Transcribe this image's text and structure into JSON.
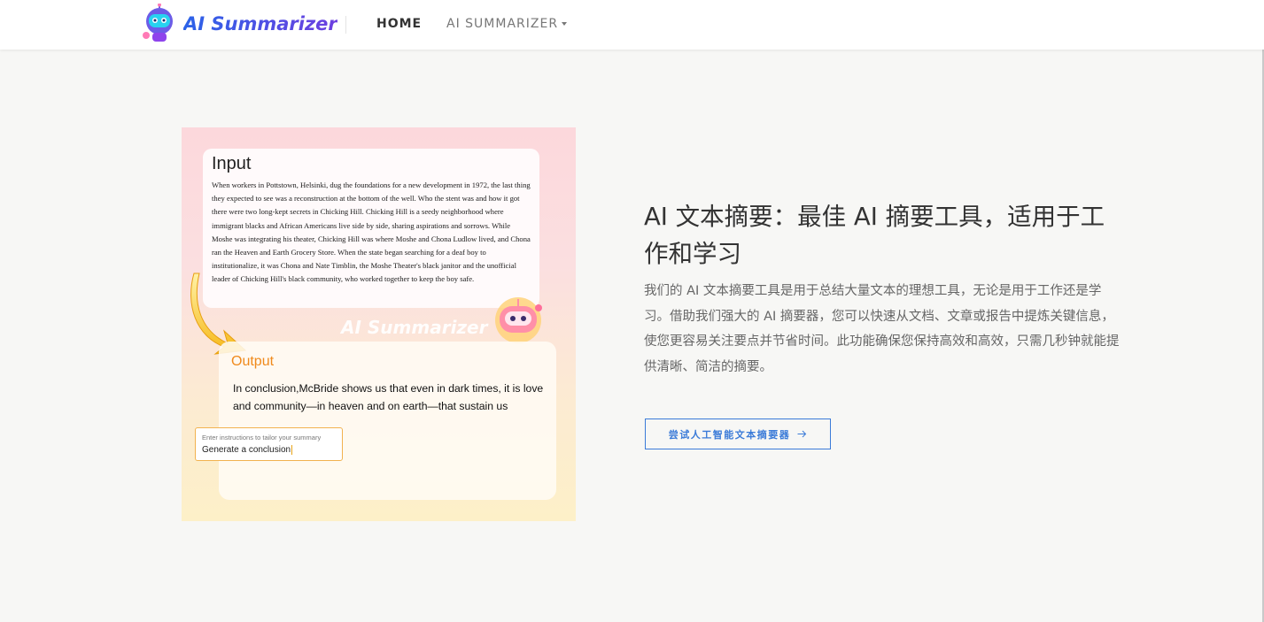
{
  "header": {
    "logo_text": "AI Summarizer",
    "nav": [
      {
        "label": "HOME"
      },
      {
        "label": "AI SUMMARIZER"
      }
    ]
  },
  "illustration": {
    "input_title": "Input",
    "input_text": "When workers in Pottstown, Helsinki, dug the foundations for a new development in 1972, the last thing they expected to see was a reconstruction at the bottom of the well. Who the stent was and how it got there were two long-kept secrets in Chicking Hill. Chicking Hill is a seedy neighborhood where immigrant blacks and African Americans live side by side, sharing aspirations and sorrows. While Moshe was integrating his theater, Chicking Hill was where Moshe and Chona Ludlow lived, and Chona ran the Heaven and Earth Grocery Store. When the state began searching for a deaf boy to institutionalize, it was Chona and Nate Timblin, the Moshe Theater's black janitor and the unofficial leader of Chicking Hill's black community, who worked together to keep the boy safe.",
    "watermark": "AI Summarizer",
    "output_title": "Output",
    "output_text": "In conclusion,McBride shows us that even in dark times, it is love and community—in heaven and on earth—that sustain us",
    "instruction_placeholder": "Enter instructions to tailor your summary",
    "instruction_value": "Generate a conclusion"
  },
  "hero": {
    "title": "AI 文本摘要：最佳 AI 摘要工具，适用于工作和学习",
    "description": "我们的 AI 文本摘要工具是用于总结大量文本的理想工具，无论是用于工作还是学习。借助我们强大的 AI 摘要器，您可以快速从文档、文章或报告中提炼关键信息，使您更容易关注要点并节省时间。此功能确保您保持高效和高效，只需几秒钟就能提供清晰、简洁的摘要。",
    "cta_label": "尝试人工智能文本摘要器",
    "cta_icon": "arrow-right-icon"
  },
  "colors": {
    "accent": "#3b7bd8",
    "output_title": "#f08a1c",
    "background": "#f7f7f5"
  }
}
